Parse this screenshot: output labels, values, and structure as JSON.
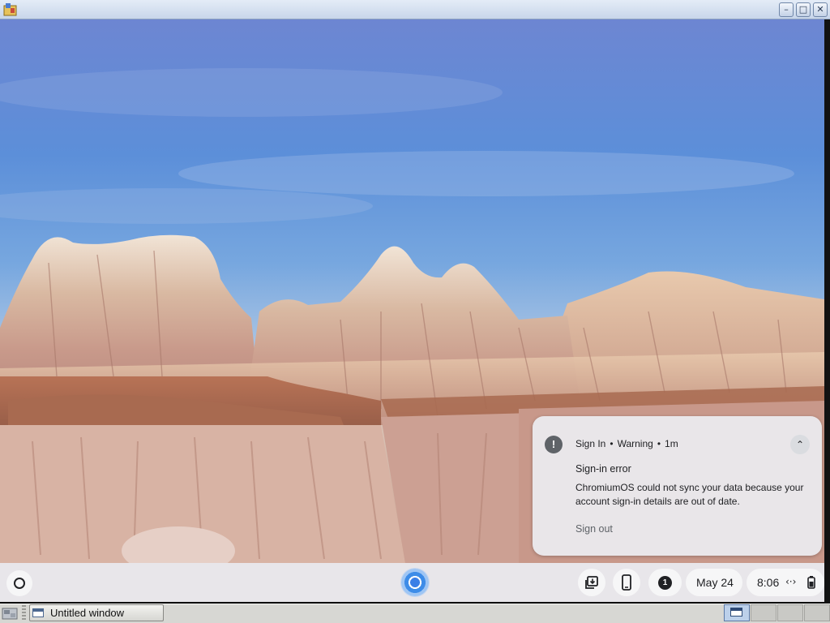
{
  "window": {
    "controls": {
      "minimize": "–",
      "maximize": "□",
      "close": "✕"
    }
  },
  "notification": {
    "icon": "warning-icon",
    "app": "Sign In",
    "separator": "•",
    "severity": "Warning",
    "age": "1m",
    "collapse_glyph": "⌃",
    "title": "Sign-in error",
    "message": "ChromiumOS could not sync your data because your account sign-in details are out of date.",
    "action": "Sign out"
  },
  "shelf": {
    "notification_count": "1",
    "date": "May 24",
    "time": "8:06",
    "network_glyph": "‹·›",
    "battery_glyph": "▮",
    "icons": [
      "launcher-icon",
      "chromium-icon",
      "screen-capture-icon",
      "phone-hub-icon",
      "notification-counter-icon",
      "network-icon",
      "battery-icon"
    ]
  },
  "host_taskbar": {
    "task_label": "Untitled window"
  }
}
